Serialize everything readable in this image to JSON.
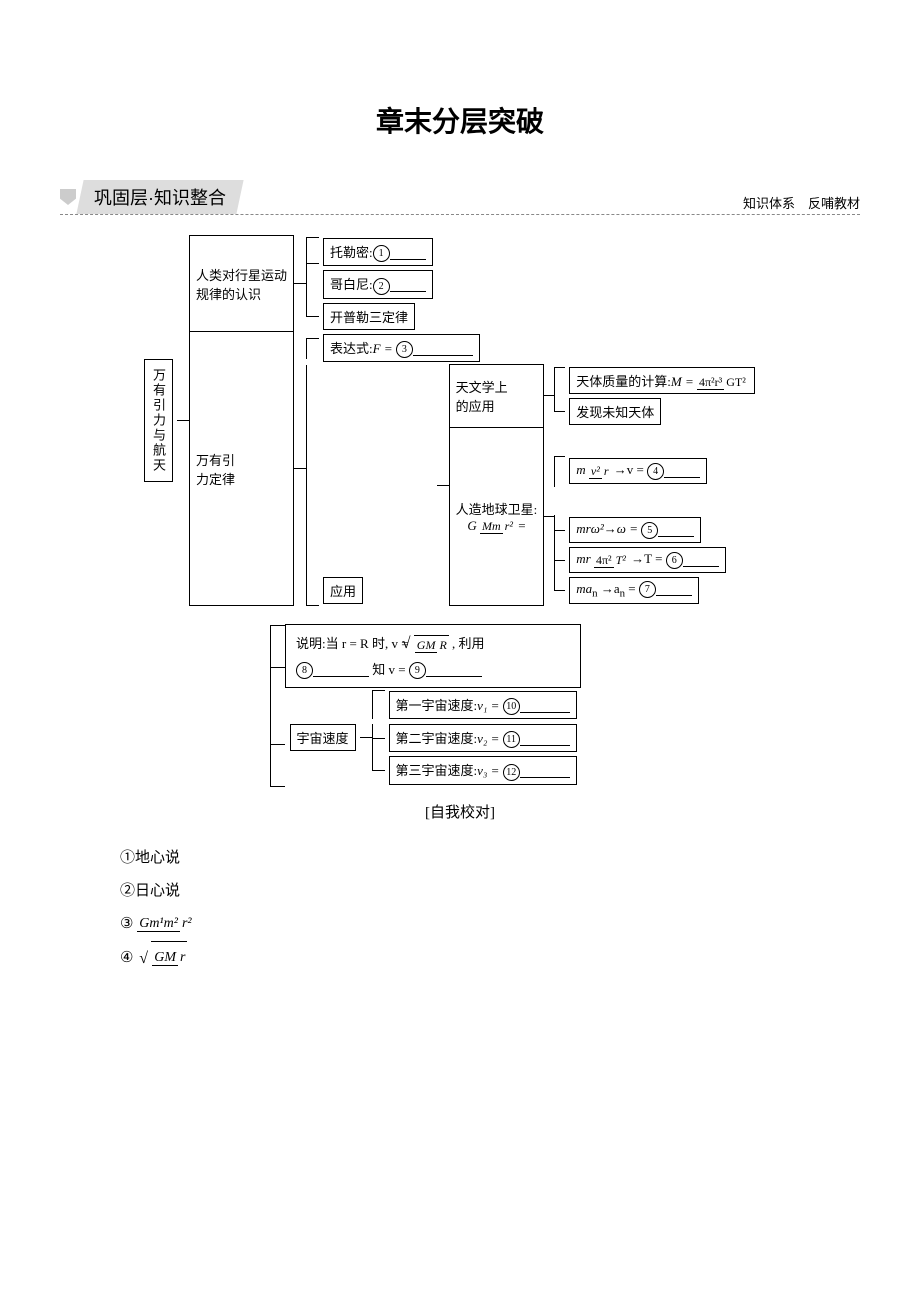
{
  "title": "章末分层突破",
  "section": {
    "arrow": "arrow",
    "label": "巩固层·知识整合",
    "right": "知识体系　反哺教材"
  },
  "root_label": "万有引力与航天",
  "branch1": {
    "label1": "人类对行星运动",
    "label2": "规律的认识",
    "items": {
      "a": "托勒密:",
      "b": "哥白尼:",
      "c": "开普勒三定律"
    }
  },
  "branch2": {
    "label1": "万有引",
    "label2": "力定律",
    "expr_label": "表达式:",
    "expr_var": "F = ",
    "app_label": "应用",
    "astro_label1": "天文学上",
    "astro_label2": "的应用",
    "mass_label": "天体质量的计算:",
    "mass_M": "M = ",
    "mass_num": "4π²r³",
    "mass_den": "GT²",
    "discover": "发现未知天体",
    "sat_label": "人造地球卫星:",
    "sat_G": "G",
    "sat_num": "Mm",
    "sat_den": "r²",
    "sat_eq": "=",
    "eq1_lhs_m": "m",
    "eq1_num": "v²",
    "eq1_den": "r",
    "eq1_arrow": "→v = ",
    "eq2_lhs": "mrω²→ω = ",
    "eq3_lhs_m": "mr",
    "eq3_num": "4π²",
    "eq3_den": "T²",
    "eq3_arrow": "→T = ",
    "eq4_lhs": "ma",
    "eq4_sub": "n",
    "eq4_arrow": "→a",
    "eq4_eq": " = "
  },
  "note": {
    "line1a": "说明:当 r = R 时, v = ",
    "line1_num": "GM",
    "line1_den": "R",
    "line1b": ", 利用",
    "line2a": "知 v = "
  },
  "cosmic": {
    "label": "宇宙速度",
    "v1": "第一宇宙速度:",
    "v1v": "v₁ = ",
    "v2": "第二宇宙速度:",
    "v2v": "v₂ = ",
    "v3": "第三宇宙速度:",
    "v3v": "v₃ = "
  },
  "circled": {
    "c1": "1",
    "c2": "2",
    "c3": "3",
    "c4": "4",
    "c5": "5",
    "c6": "6",
    "c7": "7",
    "c8": "8",
    "c9": "9",
    "c10": "10",
    "c11": "11",
    "c12": "12"
  },
  "self_check": "[自我校对]",
  "answers": {
    "a1": "①地心说",
    "a2": "②日心说",
    "a3_prefix": "③",
    "a3_num": "Gm¹m²",
    "a3_den": "r²",
    "a4_prefix": "④",
    "a4_num": "GM",
    "a4_den": "r"
  }
}
